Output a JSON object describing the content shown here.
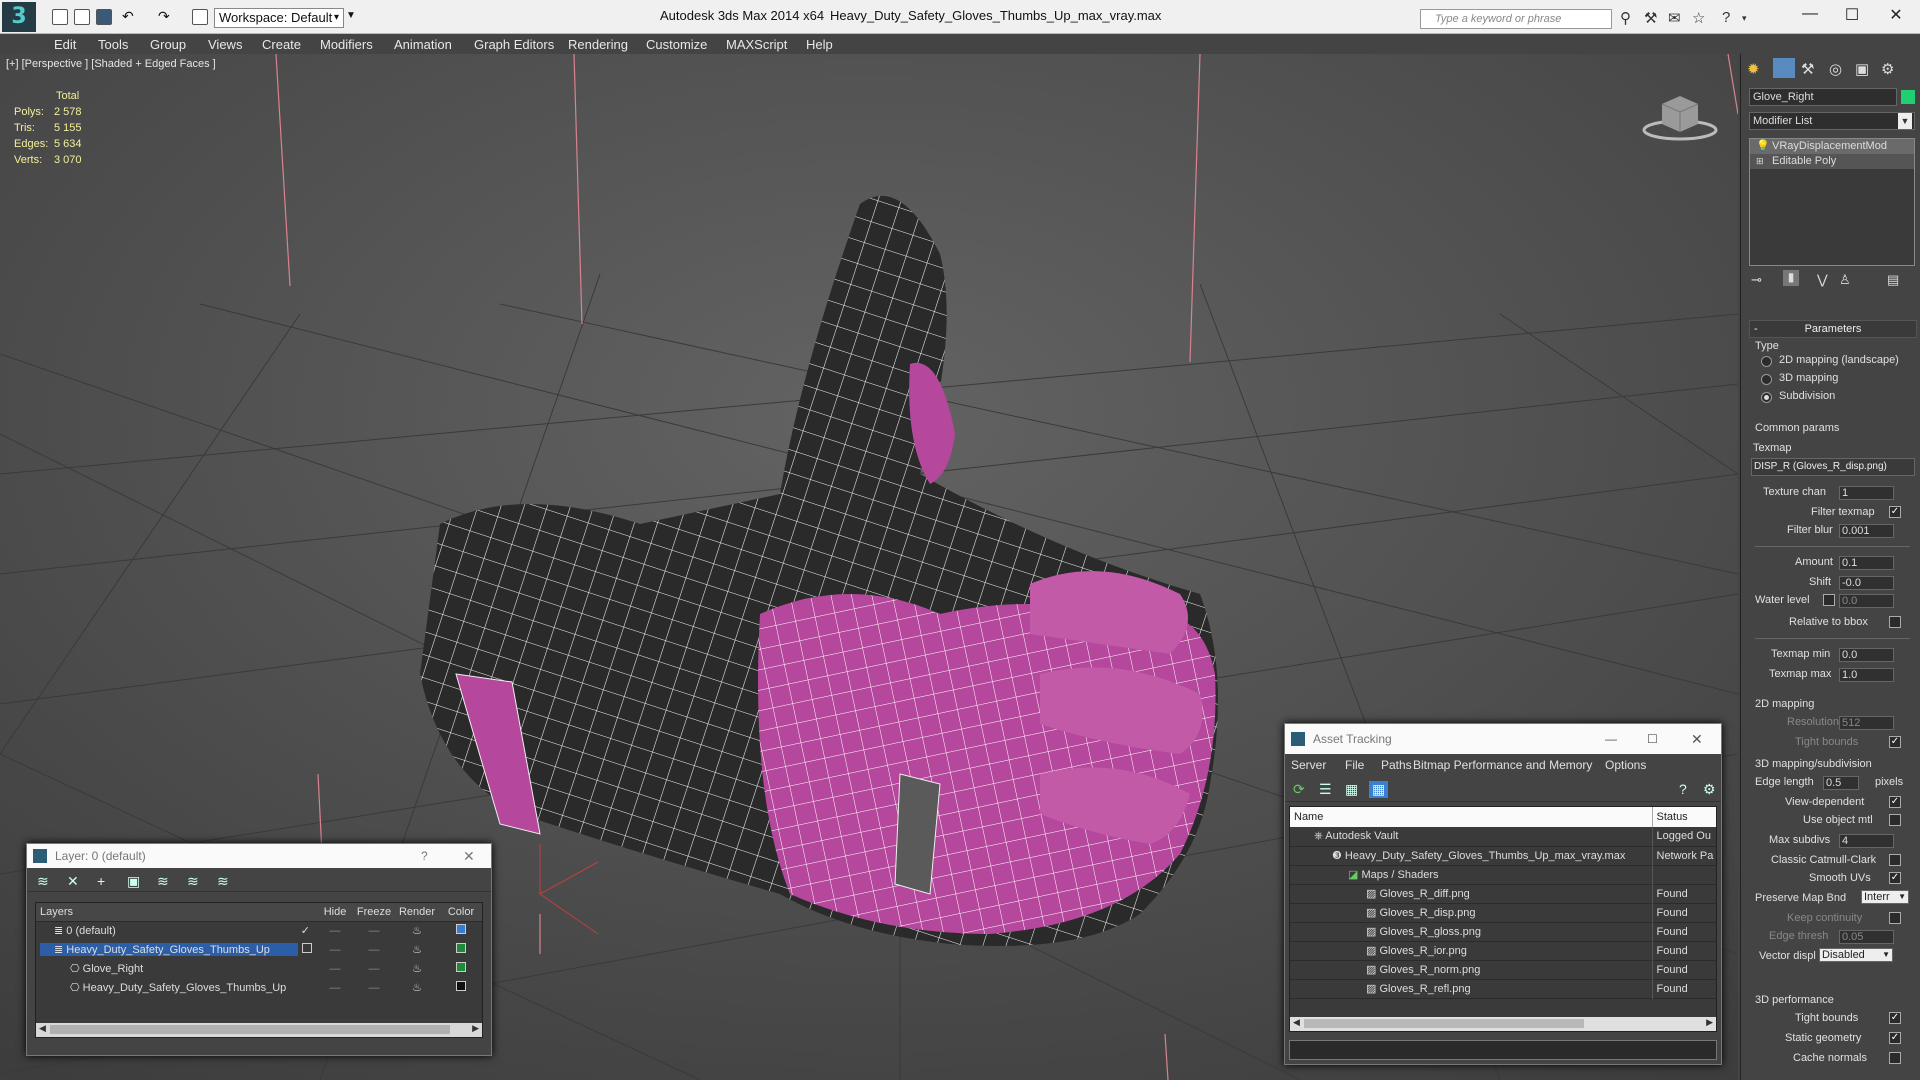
{
  "app": {
    "logo": "3",
    "title": "Autodesk 3ds Max  2014 x64",
    "file": "Heavy_Duty_Safety_Gloves_Thumbs_Up_max_vray.max",
    "workspace": "Workspace: Default",
    "search_placeholder": "Type a keyword or phrase"
  },
  "menu": [
    "Edit",
    "Tools",
    "Group",
    "Views",
    "Create",
    "Modifiers",
    "Animation",
    "Graph Editors",
    "Rendering",
    "Customize",
    "MAXScript",
    "Help"
  ],
  "viewport": {
    "label": "[+] [Perspective ] [Shaded + Edged Faces ]",
    "stats_header": "Total",
    "stats": [
      {
        "k": "Polys:",
        "v": "2 578"
      },
      {
        "k": "Tris:",
        "v": "5 155"
      },
      {
        "k": "Edges:",
        "v": "5 634"
      },
      {
        "k": "Verts:",
        "v": "3 070"
      }
    ]
  },
  "layer_panel": {
    "title": "Layer: 0 (default)",
    "help": "?",
    "columns": [
      "Layers",
      "Hide",
      "Freeze",
      "Render",
      "Color"
    ],
    "rows": [
      {
        "name": "0 (default)",
        "indent": 1,
        "color": "#3a7bd5",
        "selected": false,
        "active": true
      },
      {
        "name": "Heavy_Duty_Safety_Gloves_Thumbs_Up",
        "indent": 1,
        "color": "#1f8a3a",
        "selected": true,
        "active": false
      },
      {
        "name": "Glove_Right",
        "indent": 2,
        "color": "#1f8a3a",
        "selected": false,
        "active": false
      },
      {
        "name": "Heavy_Duty_Safety_Gloves_Thumbs_Up",
        "indent": 2,
        "color": "#111111",
        "selected": false,
        "active": false
      }
    ]
  },
  "asset_panel": {
    "title": "Asset Tracking",
    "menu": [
      "Server",
      "File",
      "Paths",
      "Bitmap Performance and Memory",
      "Options"
    ],
    "columns": [
      "Name",
      "Status"
    ],
    "rows": [
      {
        "name": "Autodesk Vault",
        "status": "Logged Ou",
        "indent": 1
      },
      {
        "name": "Heavy_Duty_Safety_Gloves_Thumbs_Up_max_vray.max",
        "status": "Network Pa",
        "indent": 2
      },
      {
        "name": "Maps / Shaders",
        "status": "",
        "indent": 3
      },
      {
        "name": "Gloves_R_diff.png",
        "status": "Found",
        "indent": 4
      },
      {
        "name": "Gloves_R_disp.png",
        "status": "Found",
        "indent": 4
      },
      {
        "name": "Gloves_R_gloss.png",
        "status": "Found",
        "indent": 4
      },
      {
        "name": "Gloves_R_ior.png",
        "status": "Found",
        "indent": 4
      },
      {
        "name": "Gloves_R_norm.png",
        "status": "Found",
        "indent": 4
      },
      {
        "name": "Gloves_R_refl.png",
        "status": "Found",
        "indent": 4
      }
    ]
  },
  "command_panel": {
    "object_name": "Glove_Right",
    "object_color": "#1fcf72",
    "modifier_list": "Modifier List",
    "stack": [
      "VRayDisplacementMod",
      "Editable Poly"
    ],
    "rollout": "Parameters",
    "type_label": "Type",
    "types": [
      "2D mapping (landscape)",
      "3D mapping",
      "Subdivision"
    ],
    "type_selected": 2,
    "common_params": "Common params",
    "texmap_label": "Texmap",
    "texmap": "DISP_R (Gloves_R_disp.png)",
    "texture_chan_label": "Texture chan",
    "texture_chan": "1",
    "filter_texmap": "Filter texmap",
    "filter_blur_label": "Filter blur",
    "filter_blur": "0.001",
    "amount_label": "Amount",
    "amount": "0.1",
    "shift_label": "Shift",
    "shift": "-0.0",
    "water_level_label": "Water level",
    "water_level": "0.0",
    "relative_bbox": "Relative to bbox",
    "texmap_min_label": "Texmap min",
    "texmap_min": "0.0",
    "texmap_max_label": "Texmap max",
    "texmap_max": "1.0",
    "mapping2d": "2D mapping",
    "resolution_label": "Resolution",
    "resolution": "512",
    "tight_bounds": "Tight bounds",
    "mapping3d": "3D mapping/subdivision",
    "edge_length_label": "Edge length",
    "edge_length": "0.5",
    "pixels": "pixels",
    "view_dependent": "View-dependent",
    "use_object_mtl": "Use object mtl",
    "max_subdivs_label": "Max subdivs",
    "max_subdivs": "4",
    "classic_catmull": "Classic Catmull-Clark",
    "smooth_uvs": "Smooth UVs",
    "preserve_label": "Preserve Map Bnd",
    "preserve": "Interr",
    "keep_continuity": "Keep continuity",
    "edge_thresh_label": "Edge thresh",
    "edge_thresh": "0.05",
    "vector_displ_label": "Vector displ",
    "vector_displ": "Disabled",
    "perf": "3D performance",
    "tight_bounds2": "Tight bounds",
    "static_geometry": "Static geometry",
    "cache_normals": "Cache normals"
  }
}
